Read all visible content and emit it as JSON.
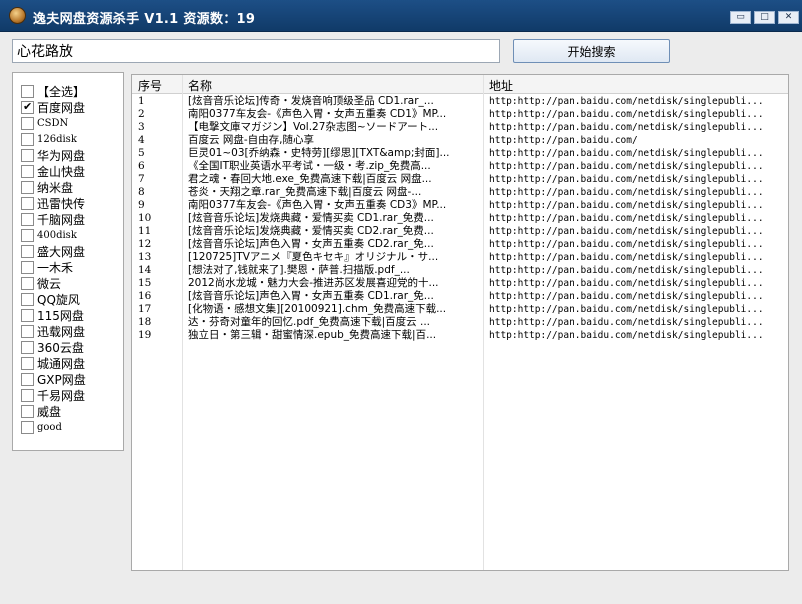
{
  "window": {
    "title": "逸夫网盘资源杀手 V1.1    资源数：19",
    "min_glyph": "▭",
    "max_glyph": "□",
    "close_glyph": "✕"
  },
  "search": {
    "value": "心花路放",
    "button_label": "开始搜索"
  },
  "sidebar": {
    "items": [
      {
        "label": "【全选】",
        "checked": false
      },
      {
        "label": "百度网盘",
        "checked": true
      },
      {
        "label": "CSDN",
        "checked": false
      },
      {
        "label": "126disk",
        "checked": false
      },
      {
        "label": "华为网盘",
        "checked": false
      },
      {
        "label": "金山快盘",
        "checked": false
      },
      {
        "label": "纳米盘",
        "checked": false
      },
      {
        "label": "迅雷快传",
        "checked": false
      },
      {
        "label": "千脑网盘",
        "checked": false
      },
      {
        "label": "400disk",
        "checked": false
      },
      {
        "label": "盛大网盘",
        "checked": false
      },
      {
        "label": "一木禾",
        "checked": false
      },
      {
        "label": "微云",
        "checked": false
      },
      {
        "label": "QQ旋风",
        "checked": false
      },
      {
        "label": "115网盘",
        "checked": false
      },
      {
        "label": "迅载网盘",
        "checked": false
      },
      {
        "label": "360云盘",
        "checked": false
      },
      {
        "label": "城通网盘",
        "checked": false
      },
      {
        "label": "GXP网盘",
        "checked": false
      },
      {
        "label": "千易网盘",
        "checked": false
      },
      {
        "label": "威盘",
        "checked": false
      },
      {
        "label": "good",
        "checked": false
      }
    ]
  },
  "table": {
    "columns": {
      "no": "序号",
      "name": "名称",
      "url": "地址"
    },
    "rows": [
      {
        "no": "1",
        "name": "[炫音音乐论坛]传奇・发烧音响顶级圣品 CD1.rar_...",
        "url": "http:http://pan.baidu.com/netdisk/singlepubli..."
      },
      {
        "no": "2",
        "name": "南阳0377车友会-《声色入胃・女声五重奏 CD1》MP...",
        "url": "http:http://pan.baidu.com/netdisk/singlepubli..."
      },
      {
        "no": "3",
        "name": "【电撃文庫マガジン】Vol.27杂志图~ソードアート...",
        "url": "http:http://pan.baidu.com/netdisk/singlepubli..."
      },
      {
        "no": "4",
        "name": "百度云 网盘-自由存,随心享",
        "url": "http:http://pan.baidu.com/"
      },
      {
        "no": "5",
        "name": "巨灵01~03[乔纳森・史特劳][缪思][TXT&amp;封面]...",
        "url": "http:http://pan.baidu.com/netdisk/singlepubli..."
      },
      {
        "no": "6",
        "name": "《全国IT职业英语水平考试・一级・考.zip_免费高...",
        "url": "http:http://pan.baidu.com/netdisk/singlepubli..."
      },
      {
        "no": "7",
        "name": "君之魂・春回大地.exe_免费高速下载|百度云 网盘...",
        "url": "http:http://pan.baidu.com/netdisk/singlepubli..."
      },
      {
        "no": "8",
        "name": "苍炎・天翔之章.rar_免费高速下载|百度云 网盘-...",
        "url": "http:http://pan.baidu.com/netdisk/singlepubli..."
      },
      {
        "no": "9",
        "name": "南阳0377车友会-《声色入胃・女声五重奏 CD3》MP...",
        "url": "http:http://pan.baidu.com/netdisk/singlepubli..."
      },
      {
        "no": "10",
        "name": "[炫音音乐论坛]发烧典藏・爱情买卖 CD1.rar_免费...",
        "url": "http:http://pan.baidu.com/netdisk/singlepubli..."
      },
      {
        "no": "11",
        "name": "[炫音音乐论坛]发烧典藏・爱情买卖 CD2.rar_免费...",
        "url": "http:http://pan.baidu.com/netdisk/singlepubli..."
      },
      {
        "no": "12",
        "name": "[炫音音乐论坛]声色入胃・女声五重奏 CD2.rar_免...",
        "url": "http:http://pan.baidu.com/netdisk/singlepubli..."
      },
      {
        "no": "13",
        "name": "[120725]TVアニメ『夏色キセキ』オリジナル・サ...",
        "url": "http:http://pan.baidu.com/netdisk/singlepubli..."
      },
      {
        "no": "14",
        "name": "[想法对了,钱就来了].樊恩・萨普.扫描版.pdf_...",
        "url": "http:http://pan.baidu.com/netdisk/singlepubli..."
      },
      {
        "no": "15",
        "name": "2012尚水龙城・魅力大会-推进苏区发展喜迎党的十...",
        "url": "http:http://pan.baidu.com/netdisk/singlepubli..."
      },
      {
        "no": "16",
        "name": "[炫音音乐论坛]声色入胃・女声五重奏 CD1.rar_免...",
        "url": "http:http://pan.baidu.com/netdisk/singlepubli..."
      },
      {
        "no": "17",
        "name": "[化物语・感想文集][20100921].chm_免费高速下载...",
        "url": "http:http://pan.baidu.com/netdisk/singlepubli..."
      },
      {
        "no": "18",
        "name": "达・芬奇对童年的回忆.pdf_免费高速下载|百度云 ...",
        "url": "http:http://pan.baidu.com/netdisk/singlepubli..."
      },
      {
        "no": "19",
        "name": "独立日・第三辑・甜蜜情深.epub_免费高速下载|百...",
        "url": "http:http://pan.baidu.com/netdisk/singlepubli..."
      }
    ]
  }
}
